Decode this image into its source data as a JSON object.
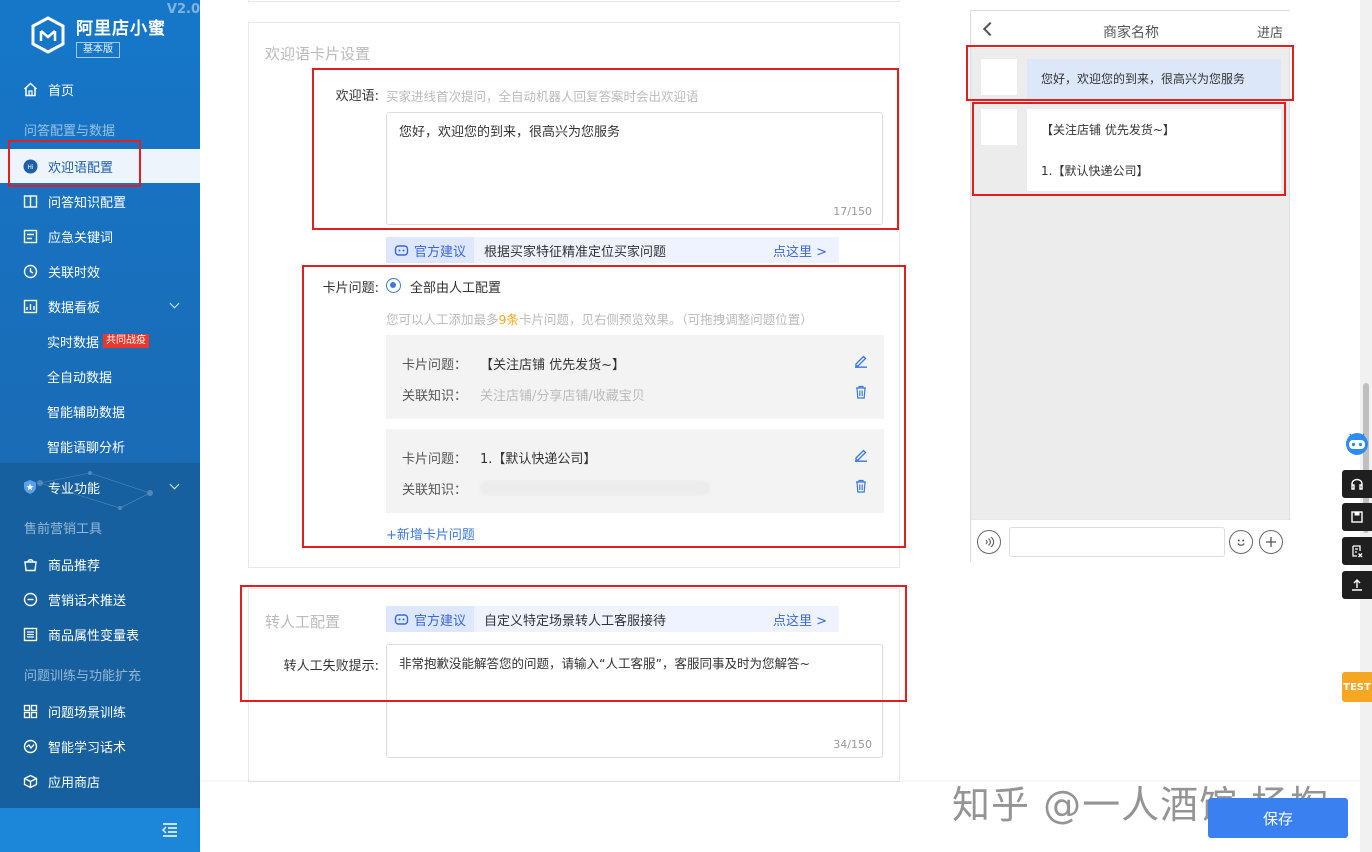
{
  "app": {
    "name": "阿里店小蜜",
    "edition": "基本版",
    "version": "V2.0"
  },
  "sidebar": {
    "home": "首页",
    "group_qa": "问答配置与数据",
    "items_qa": [
      "欢迎语配置",
      "问答知识配置",
      "应急关键词",
      "关联时效",
      "数据看板"
    ],
    "sub_items": [
      "实时数据",
      "全自动数据",
      "智能辅助数据",
      "智能语聊分析"
    ],
    "realtime_tag": "共同战疫",
    "pro": "专业功能",
    "group_marketing": "售前营销工具",
    "items_marketing": [
      "商品推荐",
      "营销话术推送",
      "商品属性变量表"
    ],
    "group_training": "问题训练与功能扩充",
    "items_training": [
      "问题场景训练",
      "智能学习话术",
      "应用商店"
    ]
  },
  "welcome_card": {
    "section_title": "欢迎语卡片设置",
    "welcome_label": "欢迎语:",
    "welcome_hint": "买家进线首次提问，全自动机器人回复答案时会出欢迎语",
    "welcome_text": "您好，欢迎您的到来，很高兴为您服务",
    "welcome_count": "17/150",
    "suggest_badge": "官方建议",
    "suggest_desc": "根据买家特征精准定位买家问题",
    "suggest_more": "点这里 >",
    "card_q_label": "卡片问题:",
    "radio_label": "全部由人工配置",
    "card_hint_pre": "您可以人工添加最多",
    "card_hint_num": "9条",
    "card_hint_post": "卡片问题，见右侧预览效果。（可拖拽调整问题位置）",
    "q_field_label": "卡片问题：",
    "k_field_label": "关联知识：",
    "questions": [
      {
        "question": "【关注店铺 优先发货~】",
        "knowledge": "关注店铺/分享店铺/收藏宝贝"
      },
      {
        "question": "1.【默认快递公司】",
        "knowledge": ""
      }
    ],
    "add_label": "+新增卡片问题"
  },
  "transfer_card": {
    "section_title": "转人工配置",
    "suggest_badge": "官方建议",
    "suggest_desc": "自定义特定场景转人工客服接待",
    "suggest_more": "点这里 >",
    "fail_label": "转人工失败提示:",
    "fail_text": "非常抱歉没能解答您的问题，请输入“人工客服”，客服同事及时为您解答~",
    "fail_count": "34/150"
  },
  "preview": {
    "title": "商家名称",
    "enter": "进店",
    "welcome": "您好，欢迎您的到来，很高兴为您服务",
    "q1": "【关注店铺 优先发货~】",
    "q2": "1.【默认快递公司】"
  },
  "tools": {
    "test_label": "TEST"
  },
  "footer": {
    "save": "保存",
    "watermark": "知乎 @一人酒馆 杨掏"
  },
  "colors": {
    "sidebar": "#1677c9",
    "accent": "#3a80f0",
    "highlight_box": "#e02020"
  }
}
